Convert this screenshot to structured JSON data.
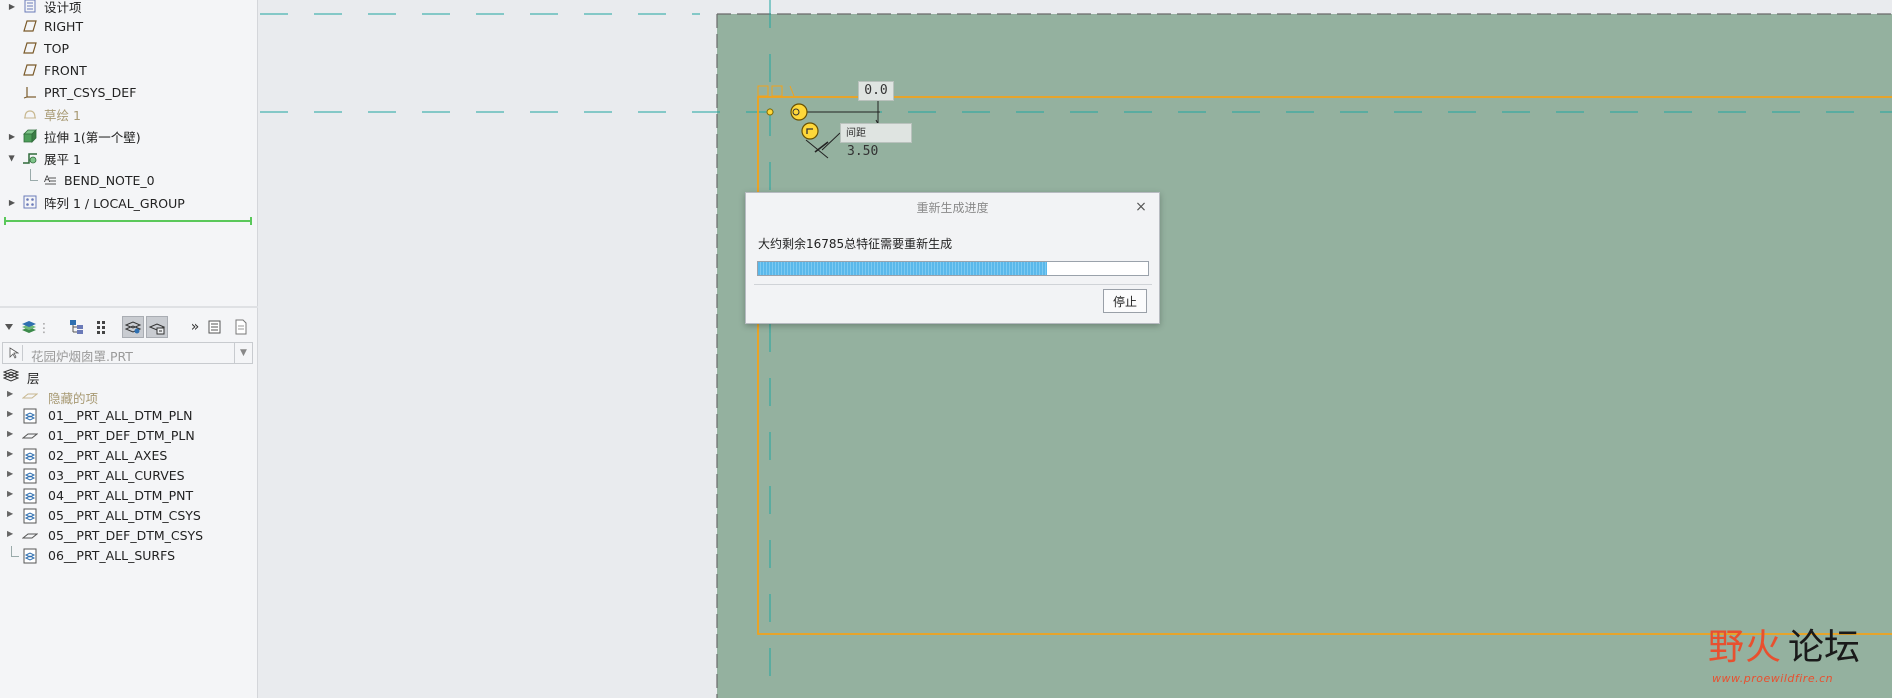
{
  "model_tree": {
    "items": [
      {
        "label": "设计项",
        "icon": "design-items-icon",
        "expandable": true
      },
      {
        "label": "RIGHT",
        "icon": "datum-plane-icon",
        "expandable": false
      },
      {
        "label": "TOP",
        "icon": "datum-plane-icon",
        "expandable": false
      },
      {
        "label": "FRONT",
        "icon": "datum-plane-icon",
        "expandable": false
      },
      {
        "label": "PRT_CSYS_DEF",
        "icon": "csys-icon",
        "expandable": false
      },
      {
        "label": "草绘 1",
        "icon": "sketch-icon",
        "expandable": false
      },
      {
        "label": "拉伸 1(第一个壁)",
        "icon": "extrude-icon",
        "expandable": true
      },
      {
        "label": "展平 1",
        "icon": "unbend-icon",
        "expandable": true
      },
      {
        "label": "BEND_NOTE_0",
        "icon": "note-icon",
        "expandable": false
      },
      {
        "label": "阵列 1 / LOCAL_GROUP",
        "icon": "pattern-icon",
        "expandable": true
      }
    ]
  },
  "layer_panel": {
    "model_select": "花园炉烟囱罩.PRT",
    "root_label": "层",
    "layers": [
      {
        "label": "隐藏的项",
        "icon": "hidden-layer-icon"
      },
      {
        "label": "01__PRT_ALL_DTM_PLN",
        "icon": "layer-icon"
      },
      {
        "label": "01__PRT_DEF_DTM_PLN",
        "icon": "plane-layer-icon"
      },
      {
        "label": "02__PRT_ALL_AXES",
        "icon": "layer-icon"
      },
      {
        "label": "03__PRT_ALL_CURVES",
        "icon": "layer-icon"
      },
      {
        "label": "04__PRT_ALL_DTM_PNT",
        "icon": "layer-icon"
      },
      {
        "label": "05__PRT_ALL_DTM_CSYS",
        "icon": "layer-icon"
      },
      {
        "label": "05__PRT_DEF_DTM_CSYS",
        "icon": "plane-layer-icon"
      },
      {
        "label": "06__PRT_ALL_SURFS",
        "icon": "layer-icon"
      }
    ]
  },
  "graphics": {
    "dim_angle": "0.0",
    "dim_gap_label": "间距",
    "dim_gap": "3.50"
  },
  "dialog": {
    "title": "重新生成进度",
    "message": "大约剩余16785总特征需要重新生成",
    "progress": 0.74,
    "stop_label": "停止",
    "close": "×"
  },
  "watermark": {
    "brand_red": "野火",
    "brand_black": "论坛",
    "url": "www.proewildfire.cn"
  },
  "colors": {
    "sheet": "#94b19f",
    "edge": "#f2a21b",
    "datum": "#1fa6a0",
    "progress": "#5ab8ea"
  }
}
